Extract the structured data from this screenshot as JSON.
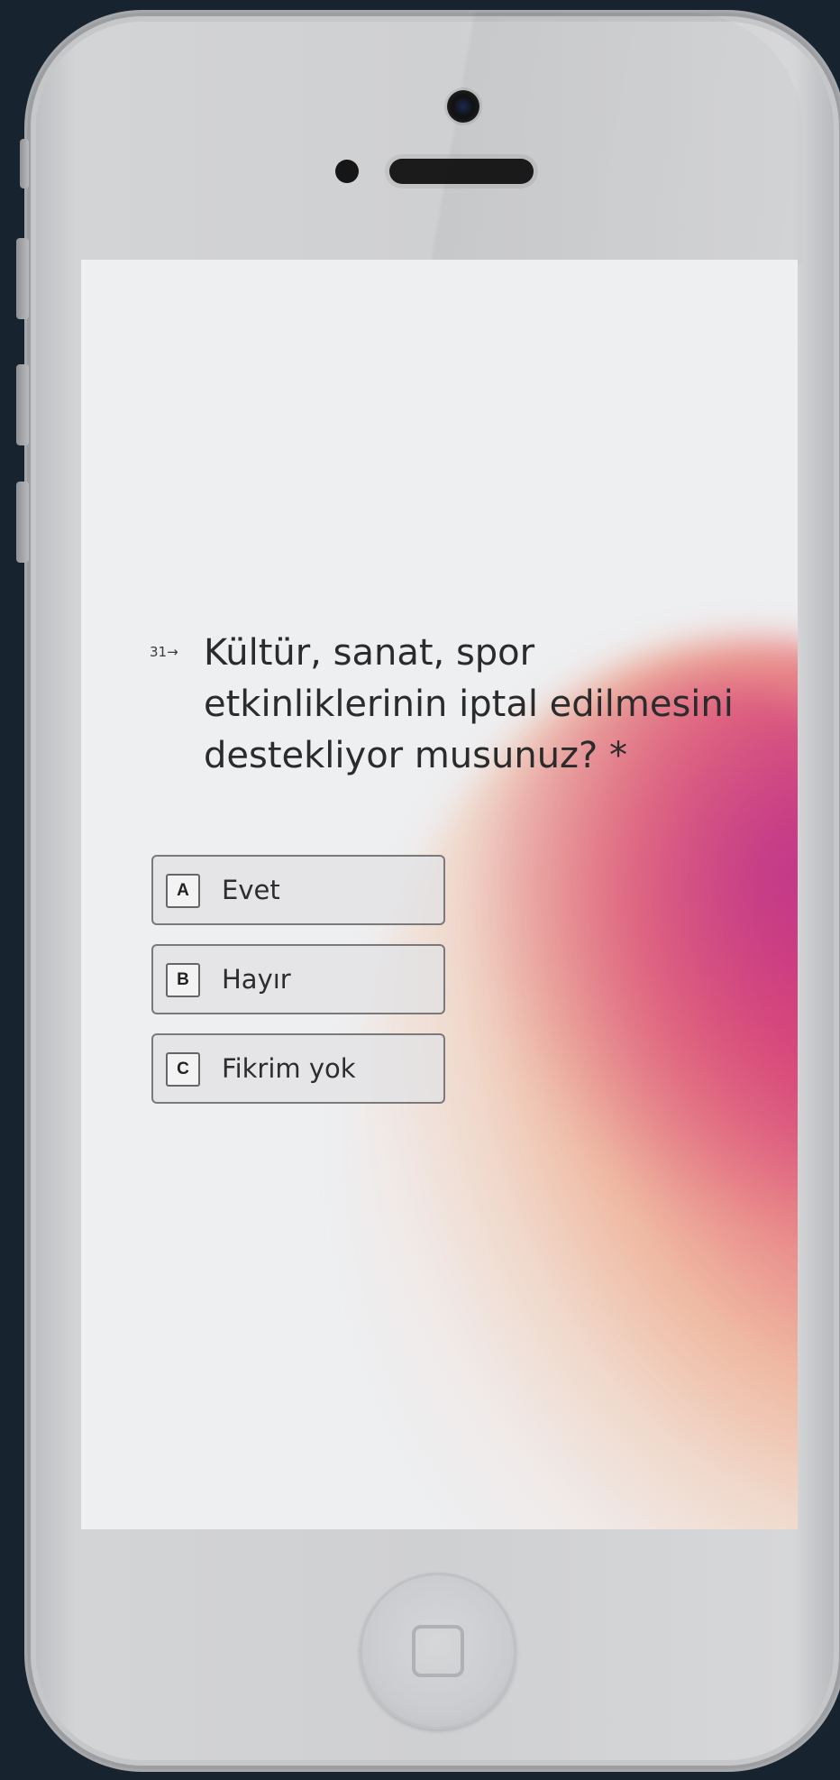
{
  "survey": {
    "question_number": "31→",
    "question_text": "Kültür, sanat, spor etkinliklerinin iptal edilmesini destekliyor musunuz? *",
    "choices": [
      {
        "key": "A",
        "label": "Evet"
      },
      {
        "key": "B",
        "label": "Hayır"
      },
      {
        "key": "C",
        "label": "Fikrim yok"
      }
    ]
  },
  "device": {
    "frame_color": "#cfd0d2",
    "background_color": "#17232e",
    "screen_background": "#eeeff1",
    "gradient_colors": [
      "#c6347e",
      "#d83c6e",
      "#f08c5f",
      "#f5b48c"
    ]
  }
}
